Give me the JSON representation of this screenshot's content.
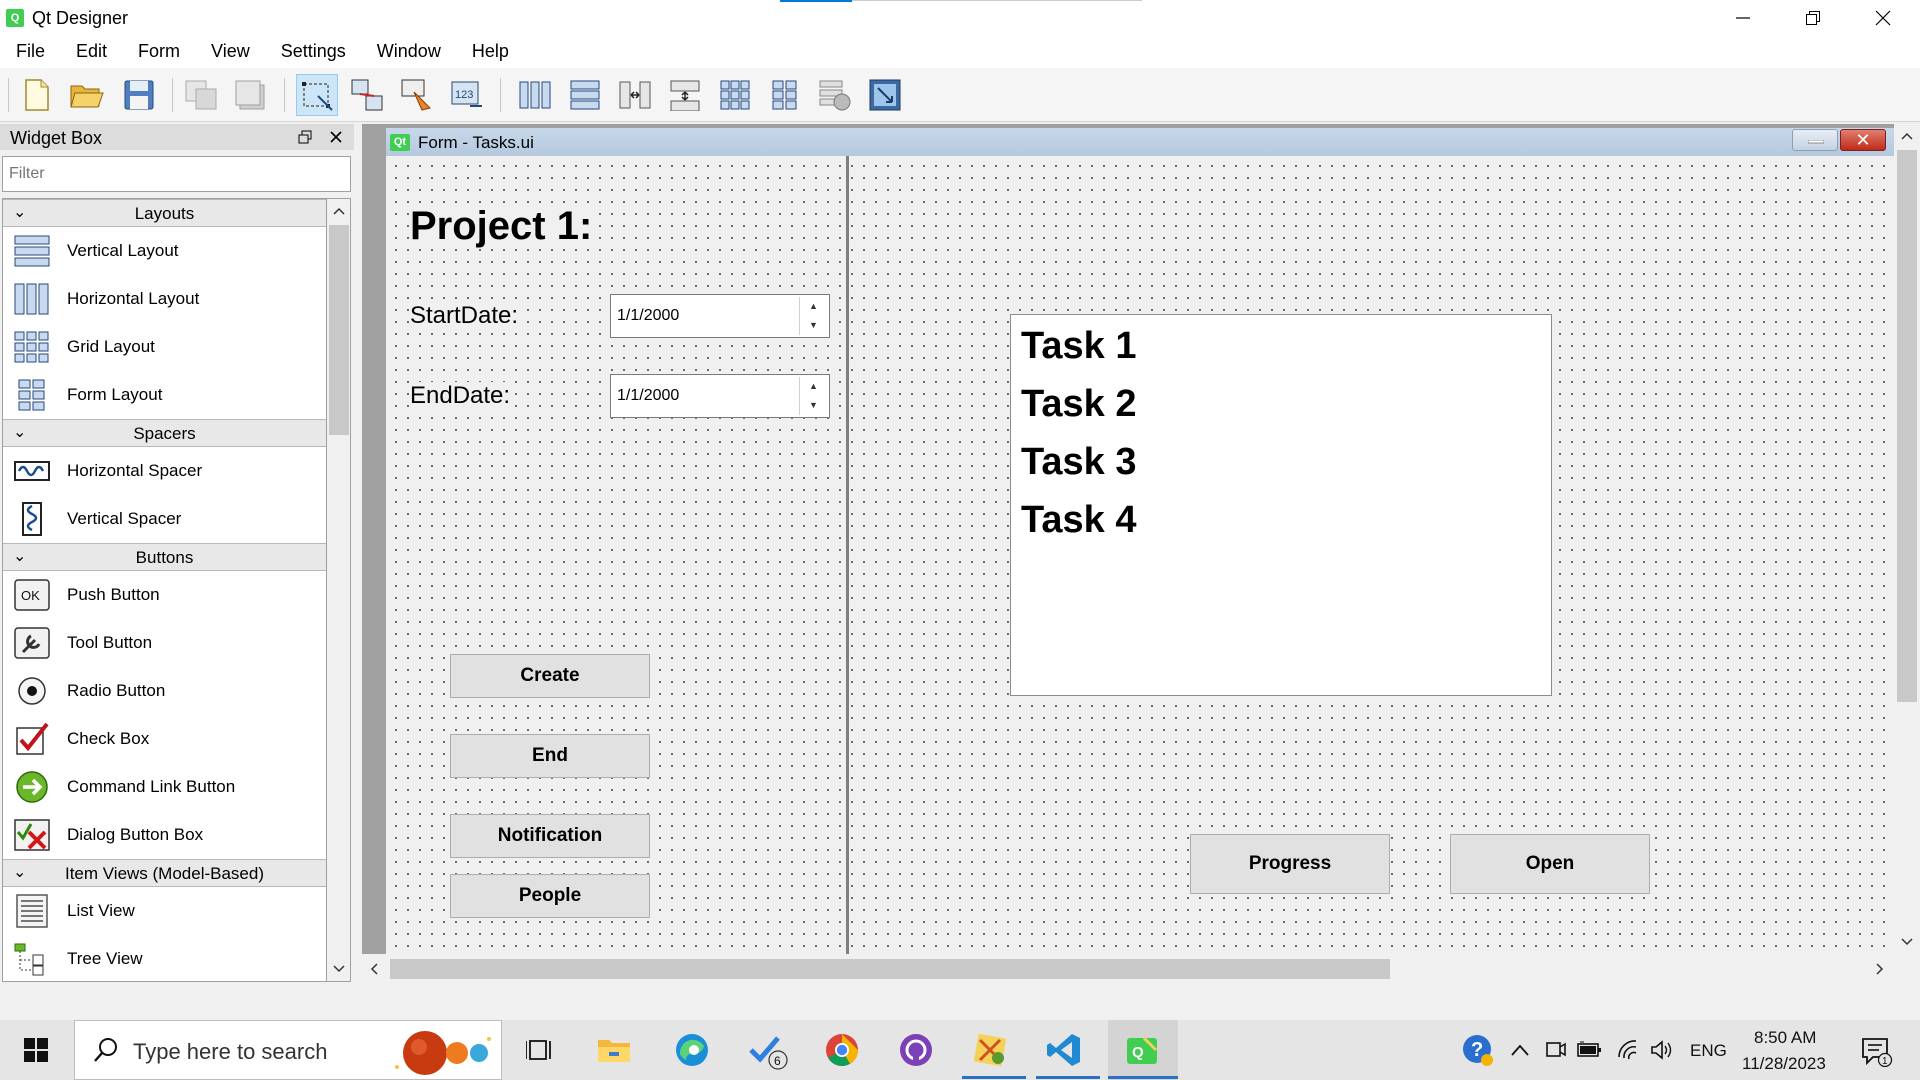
{
  "window": {
    "title": "Qt Designer"
  },
  "menu": [
    "File",
    "Edit",
    "Form",
    "View",
    "Settings",
    "Window",
    "Help"
  ],
  "widget_box": {
    "title": "Widget Box",
    "filter_placeholder": "Filter",
    "categories": [
      {
        "name": "Layouts",
        "items": [
          "Vertical Layout",
          "Horizontal Layout",
          "Grid Layout",
          "Form Layout"
        ]
      },
      {
        "name": "Spacers",
        "items": [
          "Horizontal Spacer",
          "Vertical Spacer"
        ]
      },
      {
        "name": "Buttons",
        "items": [
          "Push Button",
          "Tool Button",
          "Radio Button",
          "Check Box",
          "Command Link Button",
          "Dialog Button Box"
        ]
      },
      {
        "name": "Item Views (Model-Based)",
        "items": [
          "List View",
          "Tree View"
        ]
      }
    ]
  },
  "form": {
    "qt_badge": "Qt",
    "title": "Form - Tasks.ui",
    "heading": "Project 1:",
    "start_label": "StartDate:",
    "start_value": "1/1/2000",
    "end_label": "EndDate:",
    "end_value": "1/1/2000",
    "buttons": {
      "create": "Create",
      "end": "End",
      "notification": "Notification",
      "people": "People",
      "progress": "Progress",
      "open": "Open"
    },
    "tasks": [
      "Task 1",
      "Task 2",
      "Task 3",
      "Task 4"
    ]
  },
  "taskbar": {
    "search_placeholder": "Type here to search",
    "badge_count": "6",
    "language": "ENG",
    "time": "8:50 AM",
    "date": "11/28/2023",
    "notification_count": "1"
  },
  "colors": {
    "accent": "#0078d7",
    "qt_green": "#41cd52",
    "close_red": "#c02a1a"
  }
}
